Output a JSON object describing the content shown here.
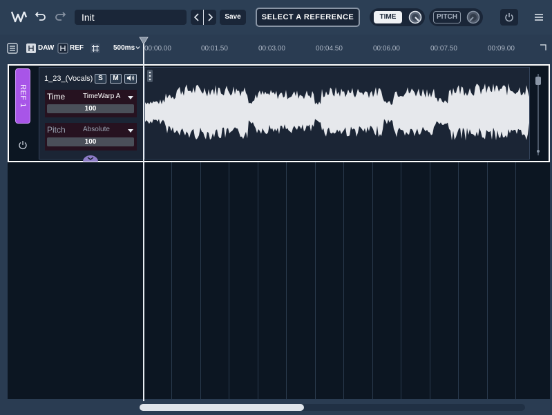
{
  "toolbar": {
    "preset_name": "Init",
    "save_label": "Save",
    "select_reference_label": "SELECT A REFERENCE",
    "time_label": "TIME",
    "pitch_label": "PITCH",
    "icons": [
      "waves-logo-icon",
      "undo-icon",
      "redo-icon",
      "chevron-left-icon",
      "chevron-right-icon",
      "power-icon",
      "hamburger-menu-icon"
    ]
  },
  "ruler": {
    "daw_label": "DAW",
    "ref_label": "REF",
    "zoom_label": "500ms",
    "ticks": [
      "00:00.00",
      "00:01.50",
      "00:03.00",
      "00:04.50",
      "00:06.00",
      "00:07.50",
      "00:09.00"
    ]
  },
  "track": {
    "ref_label": "REF 1",
    "name": "1_23_(Vocals)",
    "solo_label": "S",
    "mute_label": "M",
    "time": {
      "name": "Time",
      "mode": "TimeWarp A",
      "value": "100"
    },
    "pitch": {
      "name": "Pitch",
      "mode": "Absolute",
      "value": "100"
    }
  },
  "colors": {
    "ref_accent": "#a855e8",
    "background": "#0c1622",
    "waveform": "#e6e8ec"
  }
}
